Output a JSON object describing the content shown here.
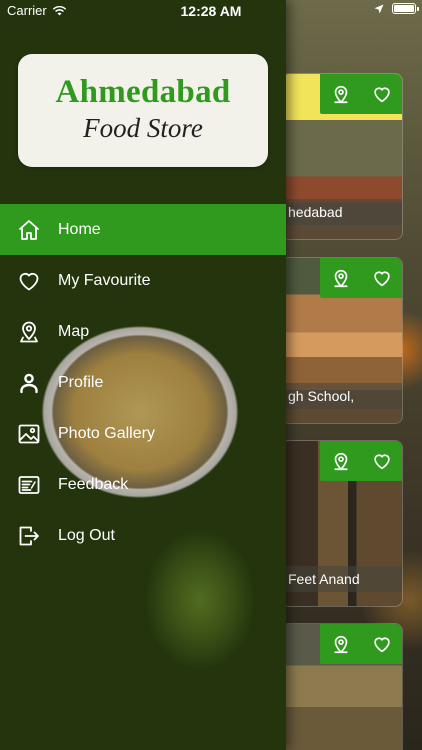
{
  "status_bar": {
    "carrier": "Carrier",
    "time": "12:28 AM"
  },
  "logo": {
    "line1": "Ahmedabad",
    "line2": "Food Store"
  },
  "menu": [
    {
      "label": "Home",
      "icon": "home-icon",
      "active": true
    },
    {
      "label": "My Favourite",
      "icon": "heart-icon",
      "active": false
    },
    {
      "label": "Map",
      "icon": "map-pin-icon",
      "active": false
    },
    {
      "label": "Profile",
      "icon": "person-icon",
      "active": false
    },
    {
      "label": "Photo Gallery",
      "icon": "image-icon",
      "active": false
    },
    {
      "label": "Feedback",
      "icon": "feedback-icon",
      "active": false
    },
    {
      "label": "Log Out",
      "icon": "logout-icon",
      "active": false
    }
  ],
  "stores": [
    {
      "label": "hedabad"
    },
    {
      "label": "gh School,"
    },
    {
      "label": " Feet Anand"
    },
    {
      "label": ""
    }
  ],
  "colors": {
    "accent": "#2f9a1e",
    "logo_text": "#2f9a1e"
  }
}
